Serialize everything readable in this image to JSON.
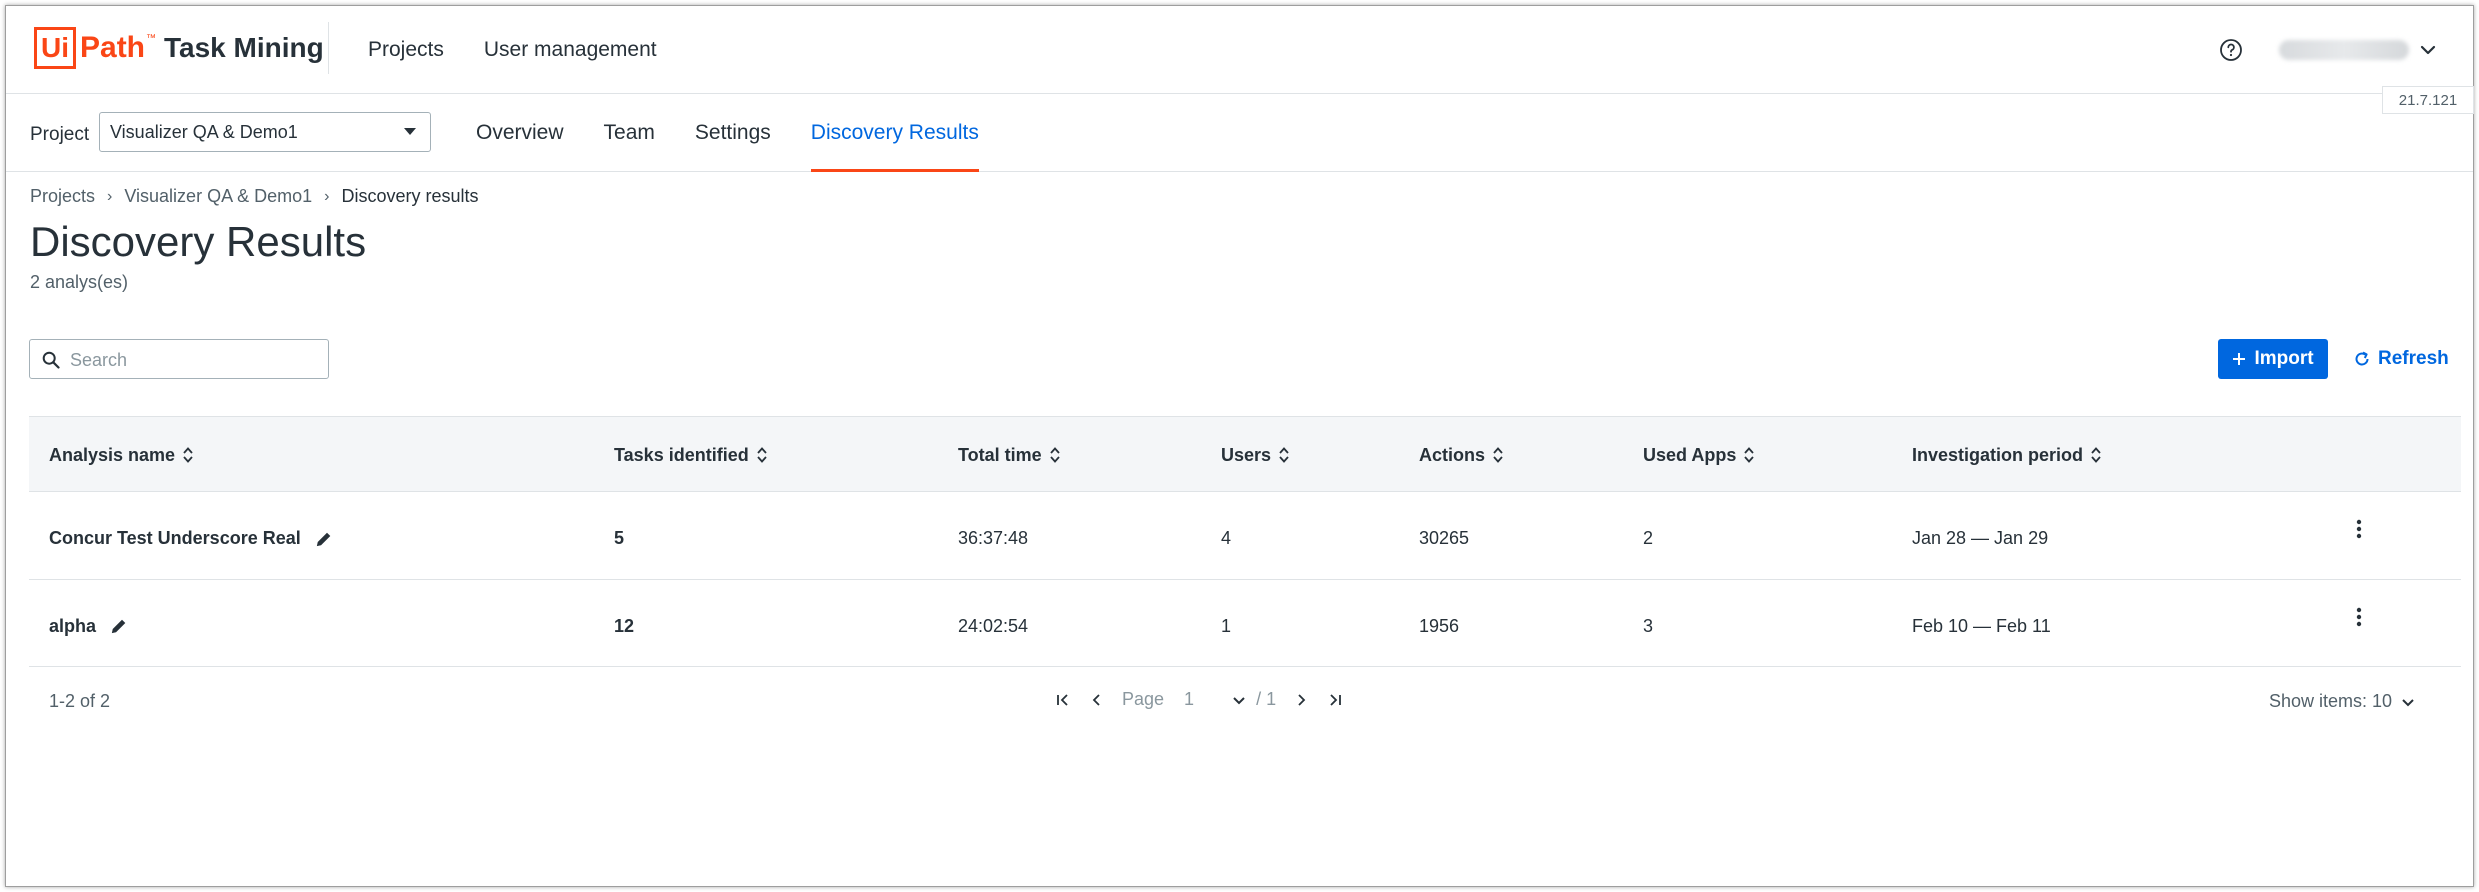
{
  "app": {
    "logo_box": "Ui",
    "logo_path": "Path",
    "logo_tm": "™",
    "product_name": "Task Mining",
    "version": "21.7.121",
    "accent_color": "#fa4616",
    "primary_color": "#0067df"
  },
  "top_nav": {
    "items": [
      {
        "label": "Projects"
      },
      {
        "label": "User management"
      }
    ]
  },
  "project_bar": {
    "project_label": "Project",
    "selected_project": "Visualizer QA & Demo1",
    "tabs": [
      {
        "label": "Overview",
        "active": false
      },
      {
        "label": "Team",
        "active": false
      },
      {
        "label": "Settings",
        "active": false
      },
      {
        "label": "Discovery Results",
        "active": true
      }
    ]
  },
  "breadcrumb": {
    "items": [
      "Projects",
      "Visualizer QA & Demo1",
      "Discovery results"
    ]
  },
  "page": {
    "title": "Discovery Results",
    "subtitle": "2 analys(es)"
  },
  "toolbar": {
    "search_placeholder": "Search",
    "import_label": "Import",
    "refresh_label": "Refresh"
  },
  "table": {
    "columns": [
      "Analysis name",
      "Tasks identified",
      "Total time",
      "Users",
      "Actions",
      "Used Apps",
      "Investigation period"
    ],
    "rows": [
      {
        "name": "Concur Test Underscore Real",
        "tasks": "5",
        "total_time": "36:37:48",
        "users": "4",
        "actions": "30265",
        "used_apps": "2",
        "period": "Jan 28 — Jan 29"
      },
      {
        "name": "alpha",
        "tasks": "12",
        "total_time": "24:02:54",
        "users": "1",
        "actions": "1956",
        "used_apps": "3",
        "period": "Feb 10 — Feb 11"
      }
    ]
  },
  "pagination": {
    "range": "1-2 of 2",
    "page_label": "Page",
    "page_value": "1",
    "total_pages": "/ 1",
    "show_items": "Show items: 10"
  }
}
